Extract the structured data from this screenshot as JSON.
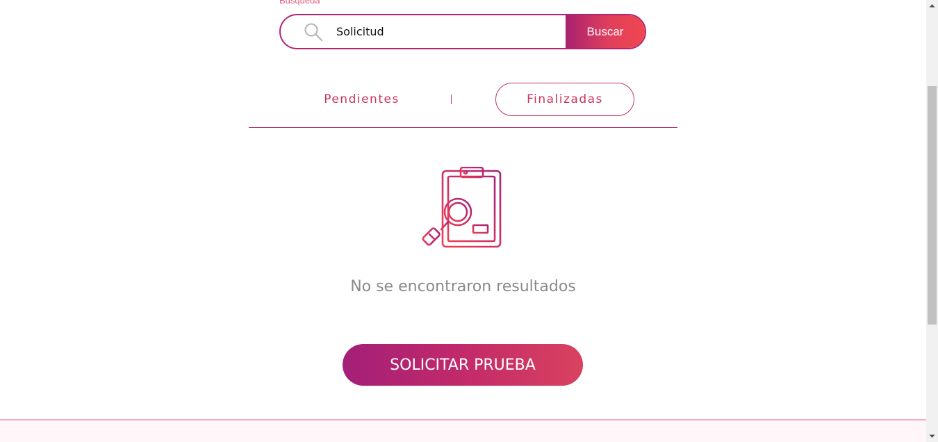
{
  "search": {
    "label": "Búsqueda",
    "value": "Solicitud",
    "button_label": "Buscar"
  },
  "tabs": [
    {
      "label": "Pendientes",
      "active": false
    },
    {
      "label": "Finalizadas",
      "active": true
    }
  ],
  "empty_state": {
    "icon": "clipboard-search-icon",
    "message": "No se encontraron resultados"
  },
  "actions": {
    "request_label": "SOLICITAR PRUEBA"
  },
  "colors": {
    "accent": "#c8345e",
    "gradient_start": "#a31f78",
    "gradient_end": "#f0474f",
    "muted_text": "#8a8a8a"
  }
}
